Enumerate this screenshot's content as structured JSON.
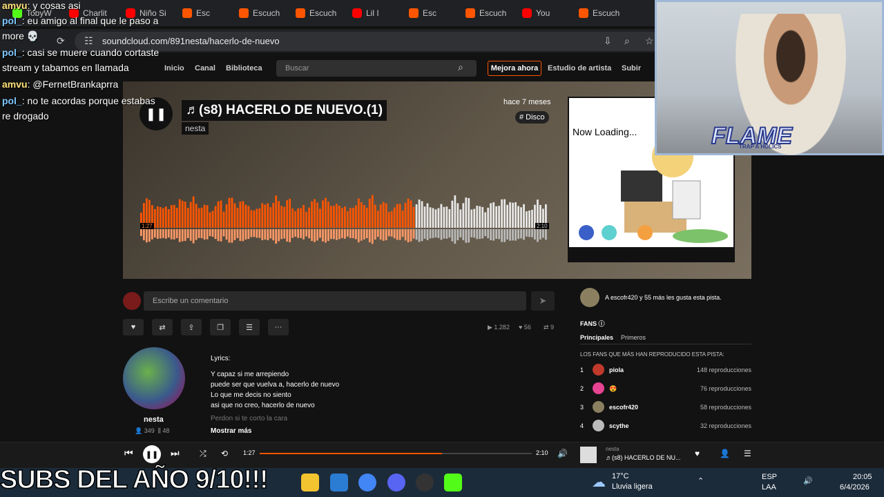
{
  "browser": {
    "tabs": [
      {
        "label": "TobyW",
        "fav": "kick"
      },
      {
        "label": "Charlit",
        "fav": "yt"
      },
      {
        "label": "Niño Si",
        "fav": "yt"
      },
      {
        "label": "Esc",
        "fav": "sc"
      },
      {
        "label": "Escuch",
        "fav": "sc"
      },
      {
        "label": "Escuch",
        "fav": "sc"
      },
      {
        "label": "Lil I",
        "fav": "yt"
      },
      {
        "label": "Esc",
        "fav": "sc"
      },
      {
        "label": "Escuch",
        "fav": "sc"
      },
      {
        "label": "You",
        "fav": "yt"
      },
      {
        "label": "Escuch",
        "fav": "sc"
      }
    ],
    "url": "soundcloud.com/891nesta/hacerlo-de-nuevo"
  },
  "soundcloud": {
    "nav": {
      "home": "Inicio",
      "feed": "Canal",
      "library": "Biblioteca"
    },
    "search_placeholder": "Buscar",
    "upgrade": "Mejora ahora",
    "studio": "Estudio de artista",
    "upload": "Subir"
  },
  "track": {
    "title": "♬(s8) HACERLO DE NUEVO.(1)",
    "artist": "nesta",
    "posted": "hace 7 meses",
    "tag": "# Disco",
    "elapsed": "1:27",
    "duration": "2:10",
    "progress": 0.67,
    "artwork_caption": "Now Loading...",
    "comment_placeholder": "Escribe un comentario",
    "plays": "1.282",
    "likes": "56",
    "reposts": "9"
  },
  "artist": {
    "name": "nesta",
    "followers": "349",
    "tracks": "48"
  },
  "lyrics": {
    "label": "Lyrics:",
    "lines": [
      "Y capaz si me arrepiendo",
      "puede ser que vuelva a, hacerlo de nuevo",
      "Lo que me decis no siento",
      "asi que no creo, hacerlo de nuevo"
    ],
    "faded": "Perdon si te corto la cara",
    "more": "Mostrar más"
  },
  "fans": {
    "likes_text": "A escofr420 y 55 más les gusta esta pista.",
    "title": "FANS",
    "tab_top": "Principales",
    "tab_first": "Primeros",
    "subtitle": "LOS FANS QUE MÁS HAN REPRODUCIDO ESTA PISTA:",
    "list": [
      {
        "rank": "1",
        "name": "piola",
        "plays": "148 reproducciones",
        "color": "#c0392b"
      },
      {
        "rank": "2",
        "name": "😍",
        "plays": "76 reproducciones",
        "color": "#e84393"
      },
      {
        "rank": "3",
        "name": "escofr420",
        "plays": "58 reproducciones",
        "color": "#8a8060"
      },
      {
        "rank": "4",
        "name": "scythe",
        "plays": "32 reproducciones",
        "color": "#bbbbbb"
      }
    ]
  },
  "player": {
    "elapsed": "1:27",
    "duration": "2:10",
    "artist": "nesta",
    "title": "♬(s8) HACERLO DE NU..."
  },
  "chat": [
    {
      "user": "amvu",
      "text": ": y cosas asi"
    },
    {
      "user": "pol_",
      "text": ": eu amigo al final que le paso a"
    },
    {
      "user": "",
      "text": "more 💀"
    },
    {
      "user": "pol_",
      "text": ": casi se muere cuando cortaste"
    },
    {
      "user": "",
      "text": "stream y tabamos en llamada"
    },
    {
      "user": "amvu",
      "text": ": @FernetBrankaprra"
    },
    {
      "user": "pol_",
      "text": ": no te acordas porque estabas"
    },
    {
      "user": "",
      "text": "re drogado"
    }
  ],
  "overlay": {
    "caption": "SUBS DEL AÑO 9/10!!!",
    "logo": "FLAME",
    "logo_sub": "TRAP A HOLICS"
  },
  "taskbar": {
    "weather_temp": "17°C",
    "weather_desc": "Lluvia ligera",
    "lang": "ESP",
    "layout": "LAA",
    "time": "20:05",
    "date": "6/4/2026"
  }
}
